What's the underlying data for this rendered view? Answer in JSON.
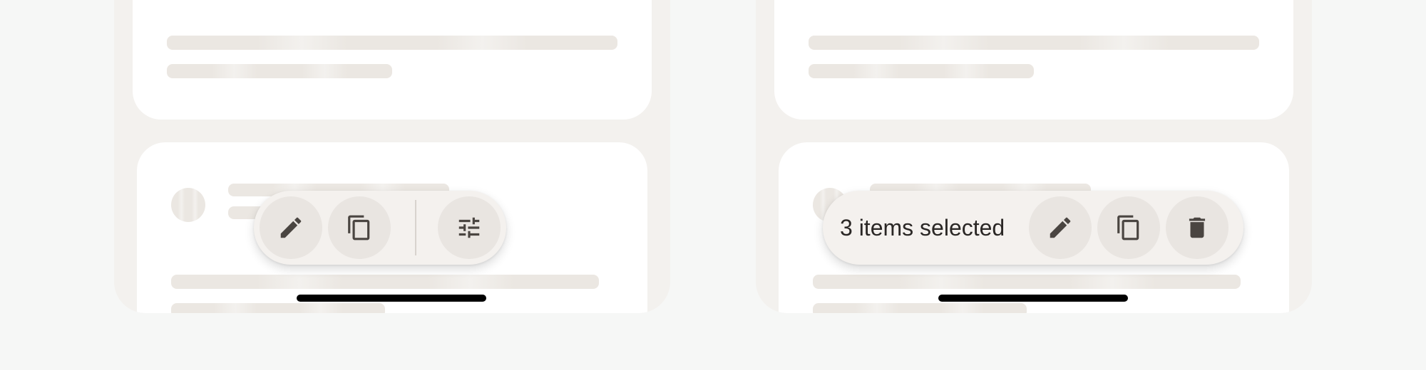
{
  "left_screen": {
    "toolbar": {
      "edit_icon": "pencil-icon",
      "duplicate_icon": "copy-icon",
      "adjust_icon": "tune-sliders-icon"
    }
  },
  "right_screen": {
    "toolbar": {
      "selection_label": "3 items selected",
      "edit_icon": "pencil-icon",
      "duplicate_icon": "copy-icon",
      "delete_icon": "trash-icon"
    }
  },
  "colors": {
    "background": "#f6f7f6",
    "screen_surface": "#f3f1ee",
    "card": "#ffffff",
    "skeleton": "#ebe7e2",
    "toolbar": "#f4f1ee",
    "button": "#e9e5e1",
    "icon": "#4a4541"
  }
}
